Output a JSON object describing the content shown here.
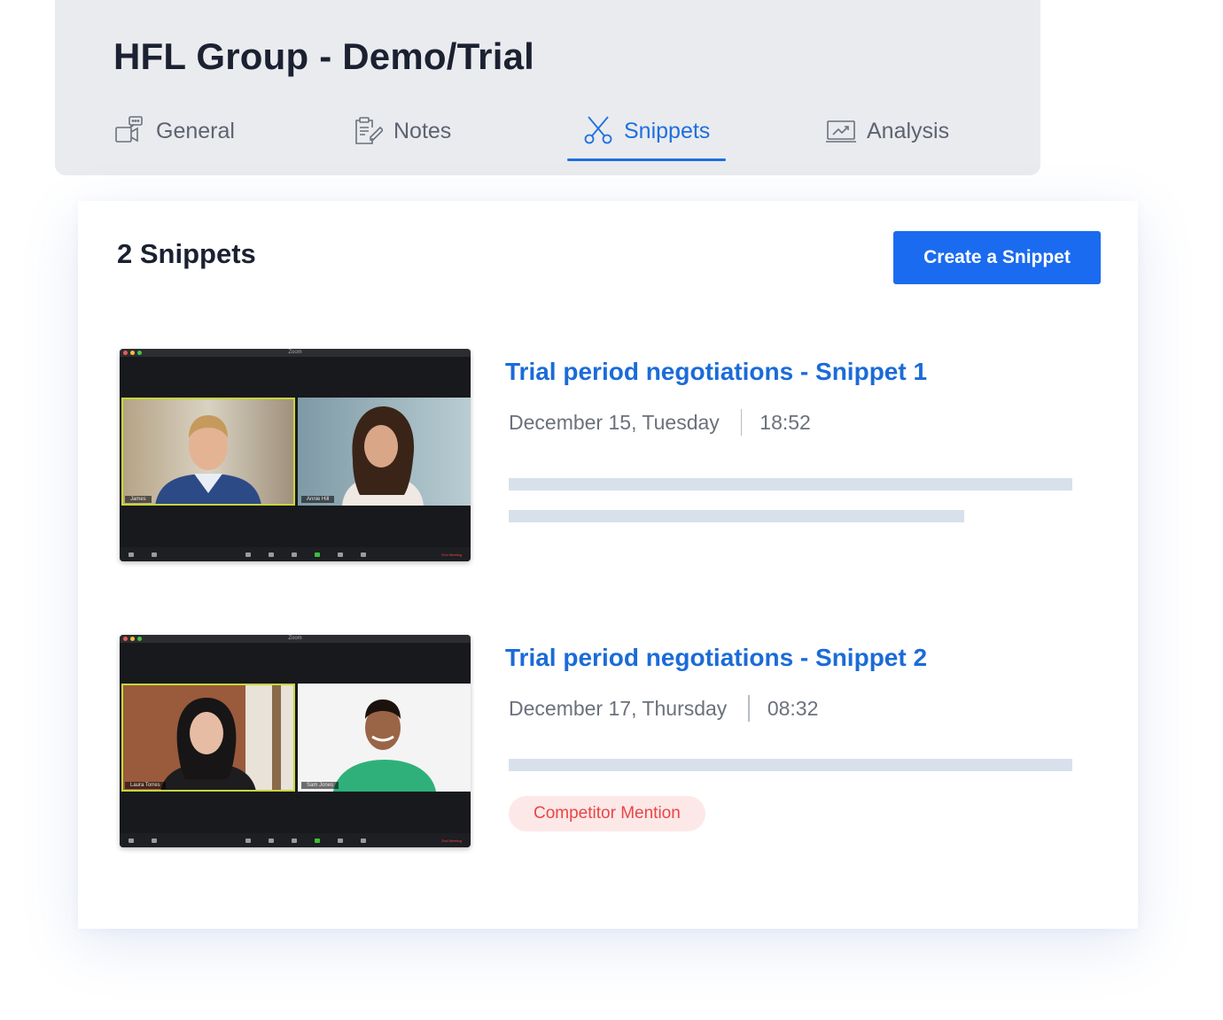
{
  "header": {
    "title": "HFL Group - Demo/Trial",
    "tabs": [
      {
        "label": "General",
        "icon": "video-chat-icon",
        "active": false
      },
      {
        "label": "Notes",
        "icon": "clipboard-edit-icon",
        "active": false
      },
      {
        "label": "Snippets",
        "icon": "scissors-icon",
        "active": true
      },
      {
        "label": "Analysis",
        "icon": "chart-screen-icon",
        "active": false
      }
    ]
  },
  "main": {
    "count_title": "2 Snippets",
    "create_button": "Create a Snippet",
    "snippets": [
      {
        "title": "Trial period negotiations - Snippet 1",
        "date": "December 15, Tuesday",
        "time": "18:52",
        "thumbnail": {
          "window_title": "Zoom",
          "participants": [
            "James",
            "Annie Hill"
          ],
          "end_label": "End Meeting"
        }
      },
      {
        "title": "Trial period negotiations - Snippet 2",
        "date": "December 17, Thursday",
        "time": "08:32",
        "tag": "Competitor Mention",
        "thumbnail": {
          "window_title": "Zoom",
          "participants": [
            "Laura Torres",
            "Sam Jones"
          ],
          "end_label": "End Meeting"
        }
      }
    ]
  },
  "colors": {
    "accent": "#1b6bf0",
    "title_link": "#1b6bd8",
    "header_bg": "#e9ebee",
    "tag_bg": "#fde8e8",
    "tag_text": "#e94545",
    "placeholder_bar": "#d8e0ec"
  }
}
